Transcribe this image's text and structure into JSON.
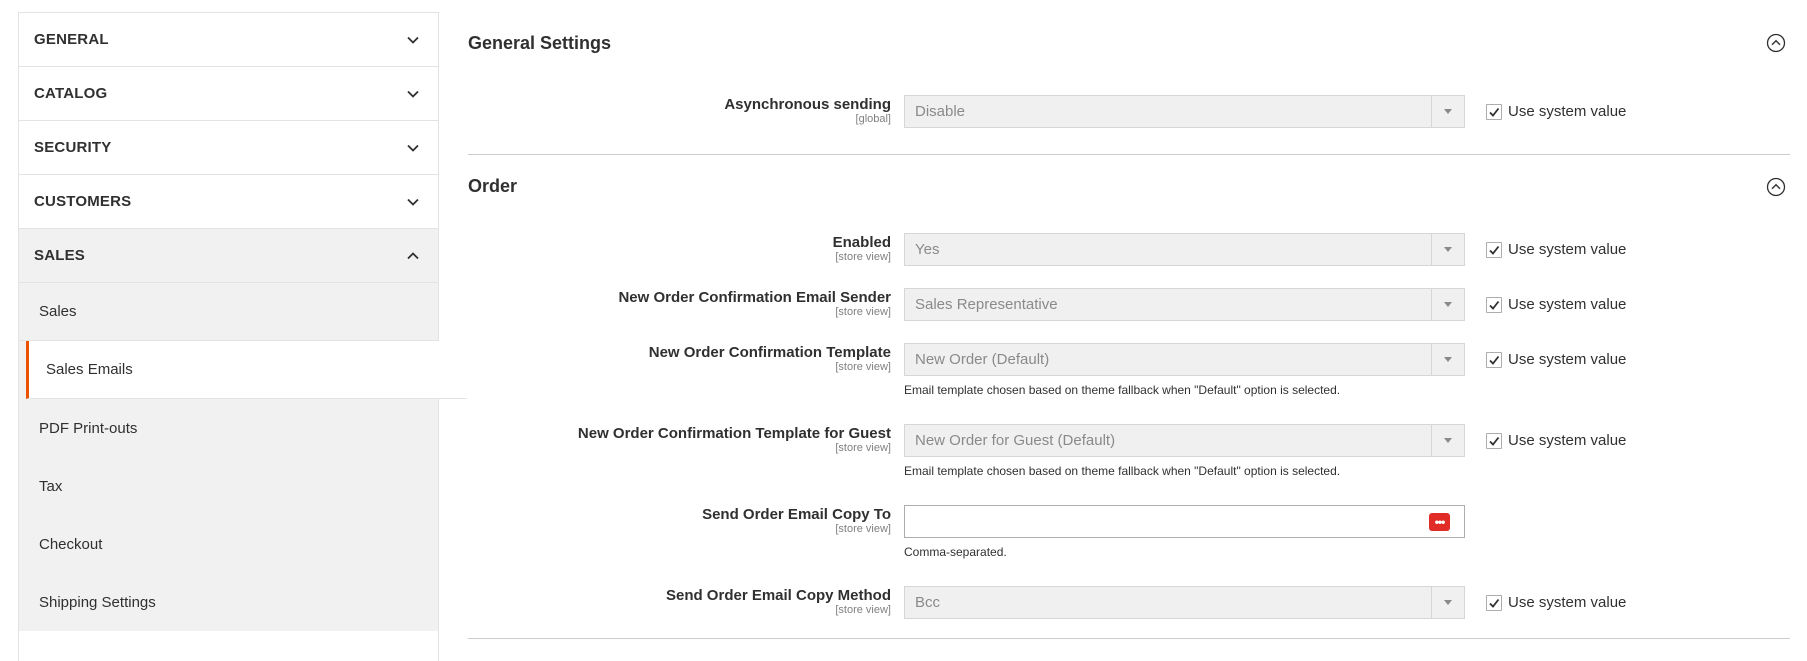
{
  "sidebar": {
    "sections": [
      {
        "label": "GENERAL"
      },
      {
        "label": "CATALOG"
      },
      {
        "label": "SECURITY"
      },
      {
        "label": "CUSTOMERS"
      },
      {
        "label": "SALES"
      }
    ],
    "sales_items": [
      {
        "label": "Sales"
      },
      {
        "label": "Sales Emails"
      },
      {
        "label": "PDF Print-outs"
      },
      {
        "label": "Tax"
      },
      {
        "label": "Checkout"
      },
      {
        "label": "Shipping Settings"
      }
    ],
    "active_item": "Sales Emails"
  },
  "general_settings": {
    "title": "General Settings",
    "async_sending": {
      "label": "Asynchronous sending",
      "scope": "[global]",
      "value": "Disable",
      "use_system": "Use system value"
    }
  },
  "order": {
    "title": "Order",
    "enabled": {
      "label": "Enabled",
      "scope": "[store view]",
      "value": "Yes",
      "use_system": "Use system value"
    },
    "sender": {
      "label": "New Order Confirmation Email Sender",
      "scope": "[store view]",
      "value": "Sales Representative",
      "use_system": "Use system value"
    },
    "template": {
      "label": "New Order Confirmation Template",
      "scope": "[store view]",
      "value": "New Order (Default)",
      "use_system": "Use system value",
      "note": "Email template chosen based on theme fallback when \"Default\" option is selected."
    },
    "guest_template": {
      "label": "New Order Confirmation Template for Guest",
      "scope": "[store view]",
      "value": "New Order for Guest (Default)",
      "use_system": "Use system value",
      "note": "Email template chosen based on theme fallback when \"Default\" option is selected."
    },
    "copy_to": {
      "label": "Send Order Email Copy To",
      "scope": "[store view]",
      "value": "",
      "note": "Comma-separated."
    },
    "copy_method": {
      "label": "Send Order Email Copy Method",
      "scope": "[store view]",
      "value": "Bcc",
      "use_system": "Use system value"
    }
  },
  "colors": {
    "accent": "#eb5202",
    "password_icon": "#e02b27"
  }
}
